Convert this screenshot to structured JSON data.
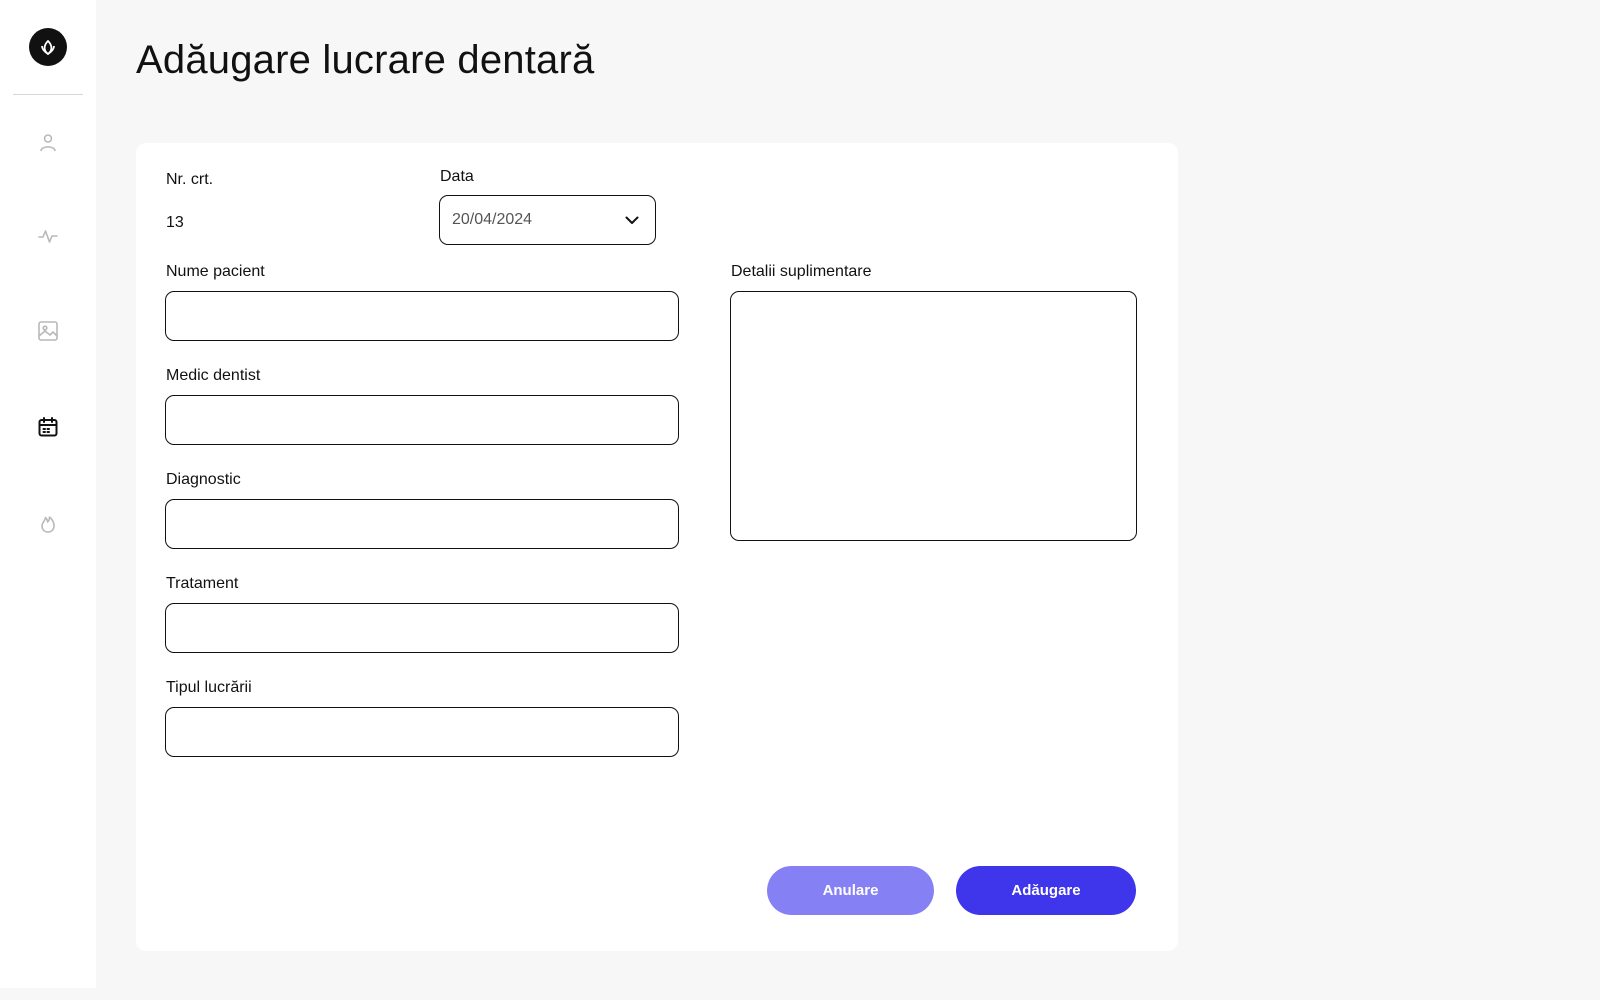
{
  "sidebar": {
    "logo_icon": "leaf-icon",
    "items": [
      {
        "name": "user-icon",
        "active": false
      },
      {
        "name": "activity-icon",
        "active": false
      },
      {
        "name": "image-icon",
        "active": false
      },
      {
        "name": "calendar-icon",
        "active": true
      },
      {
        "name": "flame-icon",
        "active": false
      }
    ]
  },
  "page": {
    "title": "Adăugare lucrare dentară"
  },
  "form": {
    "nr_label": "Nr. crt.",
    "nr_value": "13",
    "date_label": "Data",
    "date_value": "20/04/2024",
    "patient_label": "Nume pacient",
    "patient_value": "",
    "dentist_label": "Medic dentist",
    "dentist_value": "",
    "diagnosis_label": "Diagnostic",
    "diagnosis_value": "",
    "treatment_label": "Tratament",
    "treatment_value": "",
    "work_type_label": "Tipul lucrării",
    "work_type_value": "",
    "details_label": "Detalii suplimentare",
    "details_value": ""
  },
  "actions": {
    "cancel_label": "Anulare",
    "add_label": "Adăugare"
  },
  "colors": {
    "primary": "#3f35ea",
    "primary_light": "#8680f5",
    "icon_inactive": "#b9b9b9",
    "icon_active": "#111111"
  }
}
